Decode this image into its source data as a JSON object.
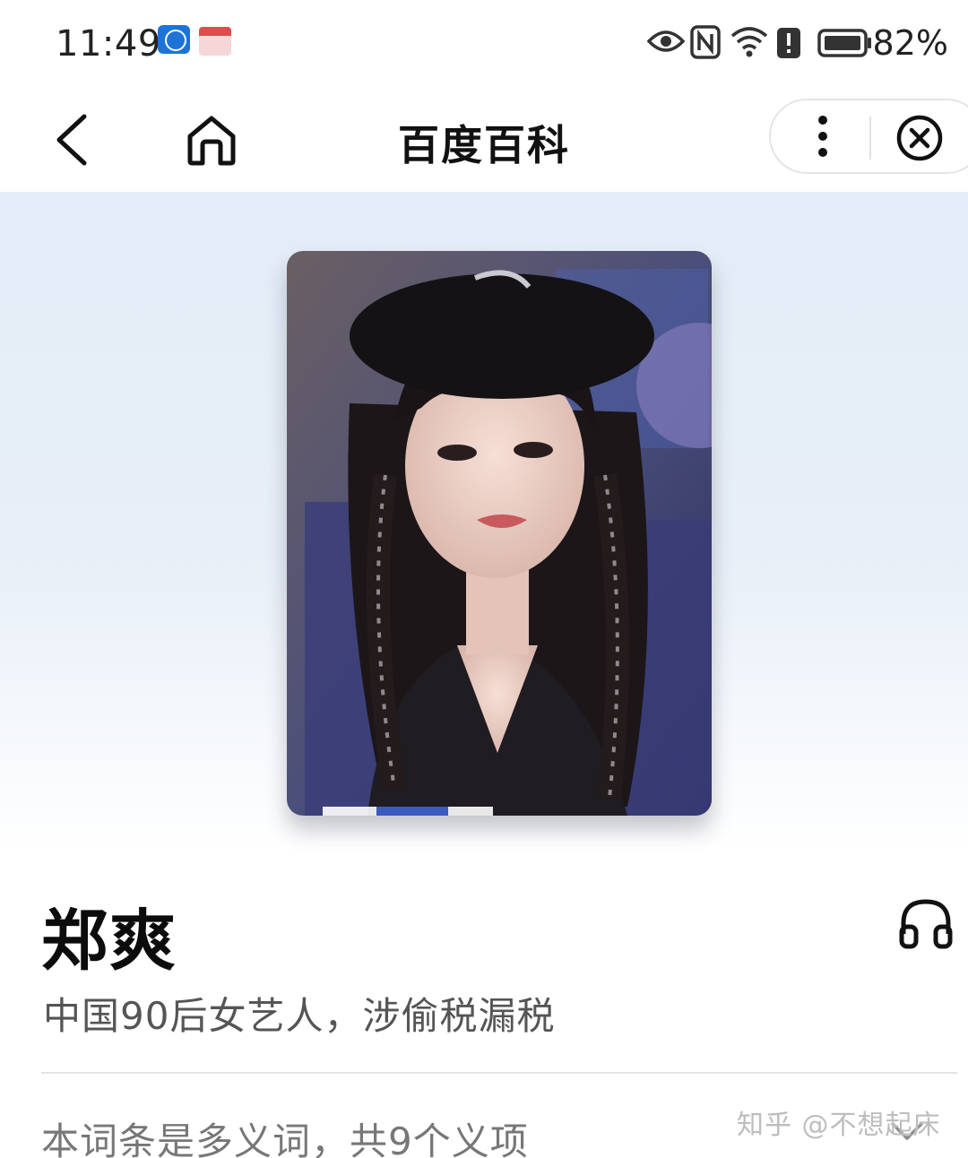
{
  "status_bar": {
    "time": "11:49",
    "battery_percent": "82%",
    "icons": [
      "browser-app-icon",
      "calendar-app-icon",
      "eye-icon",
      "nfc-icon",
      "wifi-icon",
      "alert-icon",
      "battery-icon"
    ]
  },
  "nav": {
    "title": "百度百科",
    "icons": [
      "back-icon",
      "home-icon",
      "more-vertical-icon",
      "close-circle-icon"
    ]
  },
  "hero": {
    "image": "portrait-photo"
  },
  "entry": {
    "title": "郑爽",
    "subtitle": "中国90后女艺人，涉偷税漏税",
    "polysemy_note": "本词条是多义词，共9个义项"
  },
  "watermark": "知乎 @不想起床",
  "colors": {
    "hero_gradient_top": "#e3ecf7",
    "text_primary": "#0c0c0c",
    "text_secondary": "#555555"
  }
}
